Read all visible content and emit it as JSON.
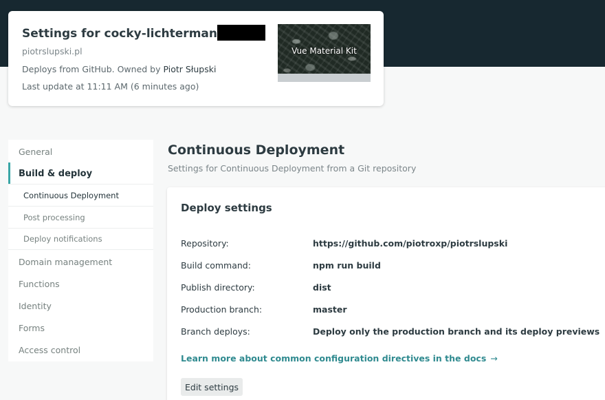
{
  "header": {
    "site_title": "Settings for cocky-lichterman",
    "site_url": "piotrslupski.pl",
    "deploy_source": "Deploys from GitHub. Owned by ",
    "owner": "Piotr Słupski",
    "last_update": "Last update at 11:11 AM (6 minutes ago)",
    "preview_title": "Vue Material Kit"
  },
  "sidebar": {
    "items": [
      {
        "label": "General"
      },
      {
        "label": "Build & deploy"
      },
      {
        "label": "Continuous Deployment"
      },
      {
        "label": "Post processing"
      },
      {
        "label": "Deploy notifications"
      },
      {
        "label": "Domain management"
      },
      {
        "label": "Functions"
      },
      {
        "label": "Identity"
      },
      {
        "label": "Forms"
      },
      {
        "label": "Access control"
      }
    ],
    "active": "Build & deploy",
    "active_sub": "Continuous Deployment"
  },
  "main": {
    "title": "Continuous Deployment",
    "subtitle": "Settings for Continuous Deployment from a Git repository",
    "panel": {
      "title": "Deploy settings",
      "rows": [
        {
          "label": "Repository:",
          "value": "https://github.com/piotroxp/piotrslupski"
        },
        {
          "label": "Build command:",
          "value": "npm run build"
        },
        {
          "label": "Publish directory:",
          "value": "dist"
        },
        {
          "label": "Production branch:",
          "value": "master"
        },
        {
          "label": "Branch deploys:",
          "value": "Deploy only the production branch and its deploy previews"
        }
      ],
      "docs_link": "Learn more about common configuration directives in the docs",
      "docs_arrow": "→",
      "edit_button": "Edit settings"
    }
  },
  "colors": {
    "top_bar": "#172830",
    "accent": "#3aa6a6",
    "link": "#2f8a8f"
  }
}
